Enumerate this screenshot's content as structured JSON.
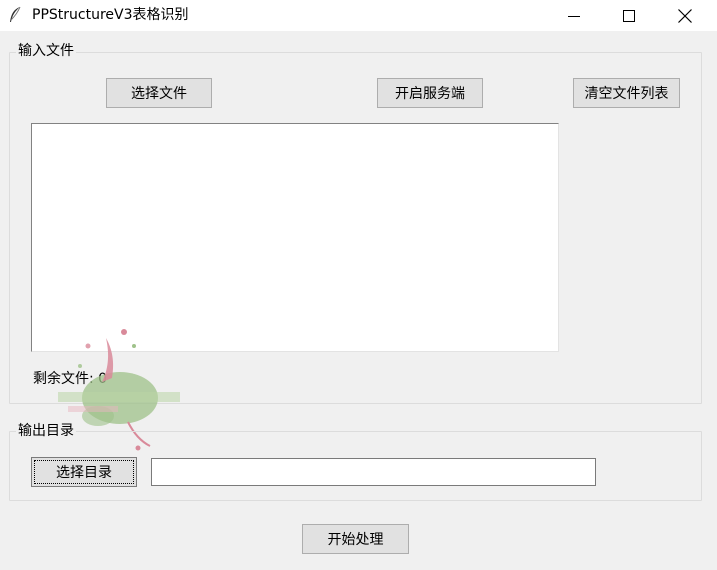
{
  "window": {
    "title": "PPStructureV3表格识别",
    "icon": "feather-icon",
    "controls": [
      "minimize-icon",
      "maximize-icon",
      "close-icon"
    ]
  },
  "input_group": {
    "label": "输入文件",
    "select_files_button": "选择文件",
    "start_server_button": "开启服务端",
    "clear_list_button": "清空文件列表",
    "files": [],
    "remaining_label": "剩余文件: 0"
  },
  "output_group": {
    "label": "输出目录",
    "select_dir_button": "选择目录",
    "dir_value": ""
  },
  "start_button": "开始处理",
  "colors": {
    "window_bg": "#f0f0f0",
    "button_bg": "#e1e1e1",
    "button_border": "#adadad",
    "watermark_green": "#9fc28a",
    "watermark_pink": "#d98a9a"
  }
}
